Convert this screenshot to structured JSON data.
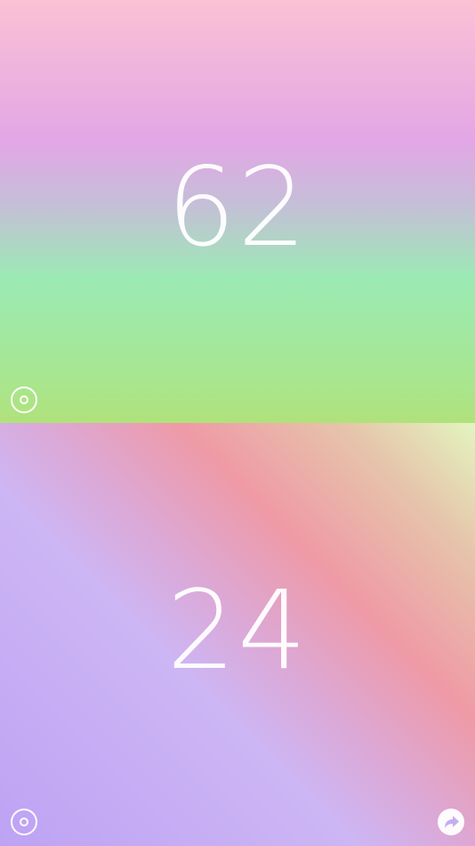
{
  "players": {
    "top": {
      "score": "62"
    },
    "bottom": {
      "score": "24"
    }
  },
  "icons": {
    "target": "target-icon",
    "share": "share-arrow-icon"
  },
  "colors": {
    "top_gradient": [
      "#fbc1d4",
      "#e3a6e6",
      "#9beab4",
      "#b0e27b"
    ],
    "bottom_gradient": [
      "#e3f5bf",
      "#ef9aa6",
      "#cdb6f4",
      "#bea2f4"
    ],
    "foreground": "#ffffff"
  }
}
